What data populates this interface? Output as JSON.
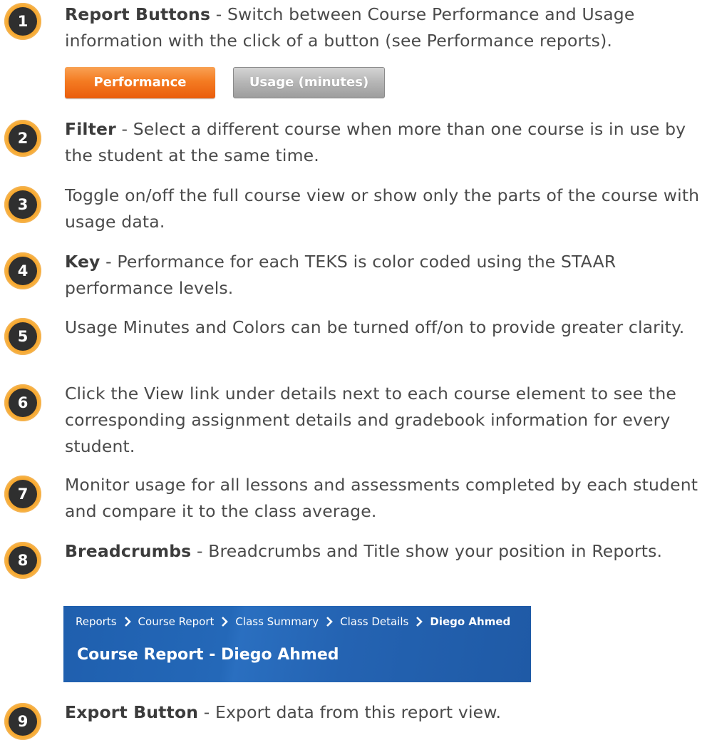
{
  "items": [
    {
      "number": "1",
      "bold": "Report Buttons",
      "text": " - Switch between Course Performance and Usage information with the click of a button (see Performance reports)."
    },
    {
      "number": "2",
      "bold": "Filter",
      "text": " - Select a different course when more than one course is in use by the student at the same time."
    },
    {
      "number": "3",
      "bold": "",
      "text": "Toggle on/off the full course view or show only the parts of the course with usage data."
    },
    {
      "number": "4",
      "bold": "Key",
      "text": " - Performance for each TEKS is color coded using the STAAR performance levels."
    },
    {
      "number": "5",
      "bold": "",
      "text": "Usage Minutes and Colors can be turned off/on to provide greater clarity."
    },
    {
      "number": "6",
      "bold": "",
      "text": "Click the View link under details next to each course element to see the corresponding assignment details and gradebook information for every student."
    },
    {
      "number": "7",
      "bold": "",
      "text": "Monitor usage for all lessons and assessments completed by each student and compare it to the class average."
    },
    {
      "number": "8",
      "bold": "Breadcrumbs",
      "text": " - Breadcrumbs and Title show your position in Reports."
    },
    {
      "number": "9",
      "bold": "Export Button",
      "text": " - Export data from this report view."
    }
  ],
  "report_buttons": {
    "performance_label": "Performance",
    "usage_label": "Usage (minutes)"
  },
  "banner": {
    "breadcrumbs": [
      "Reports",
      "Course Report",
      "Class Summary",
      "Class Details",
      "Diego Ahmed"
    ],
    "title": "Course Report - Diego Ahmed",
    "separator_icon": "chevron-right-icon"
  },
  "colors": {
    "badge_ring": "#f6a52c",
    "badge_fill": "#2f2f2f",
    "performance_button": "#f47b22",
    "usage_button": "#b5b5b5",
    "banner": "#2468b8"
  }
}
